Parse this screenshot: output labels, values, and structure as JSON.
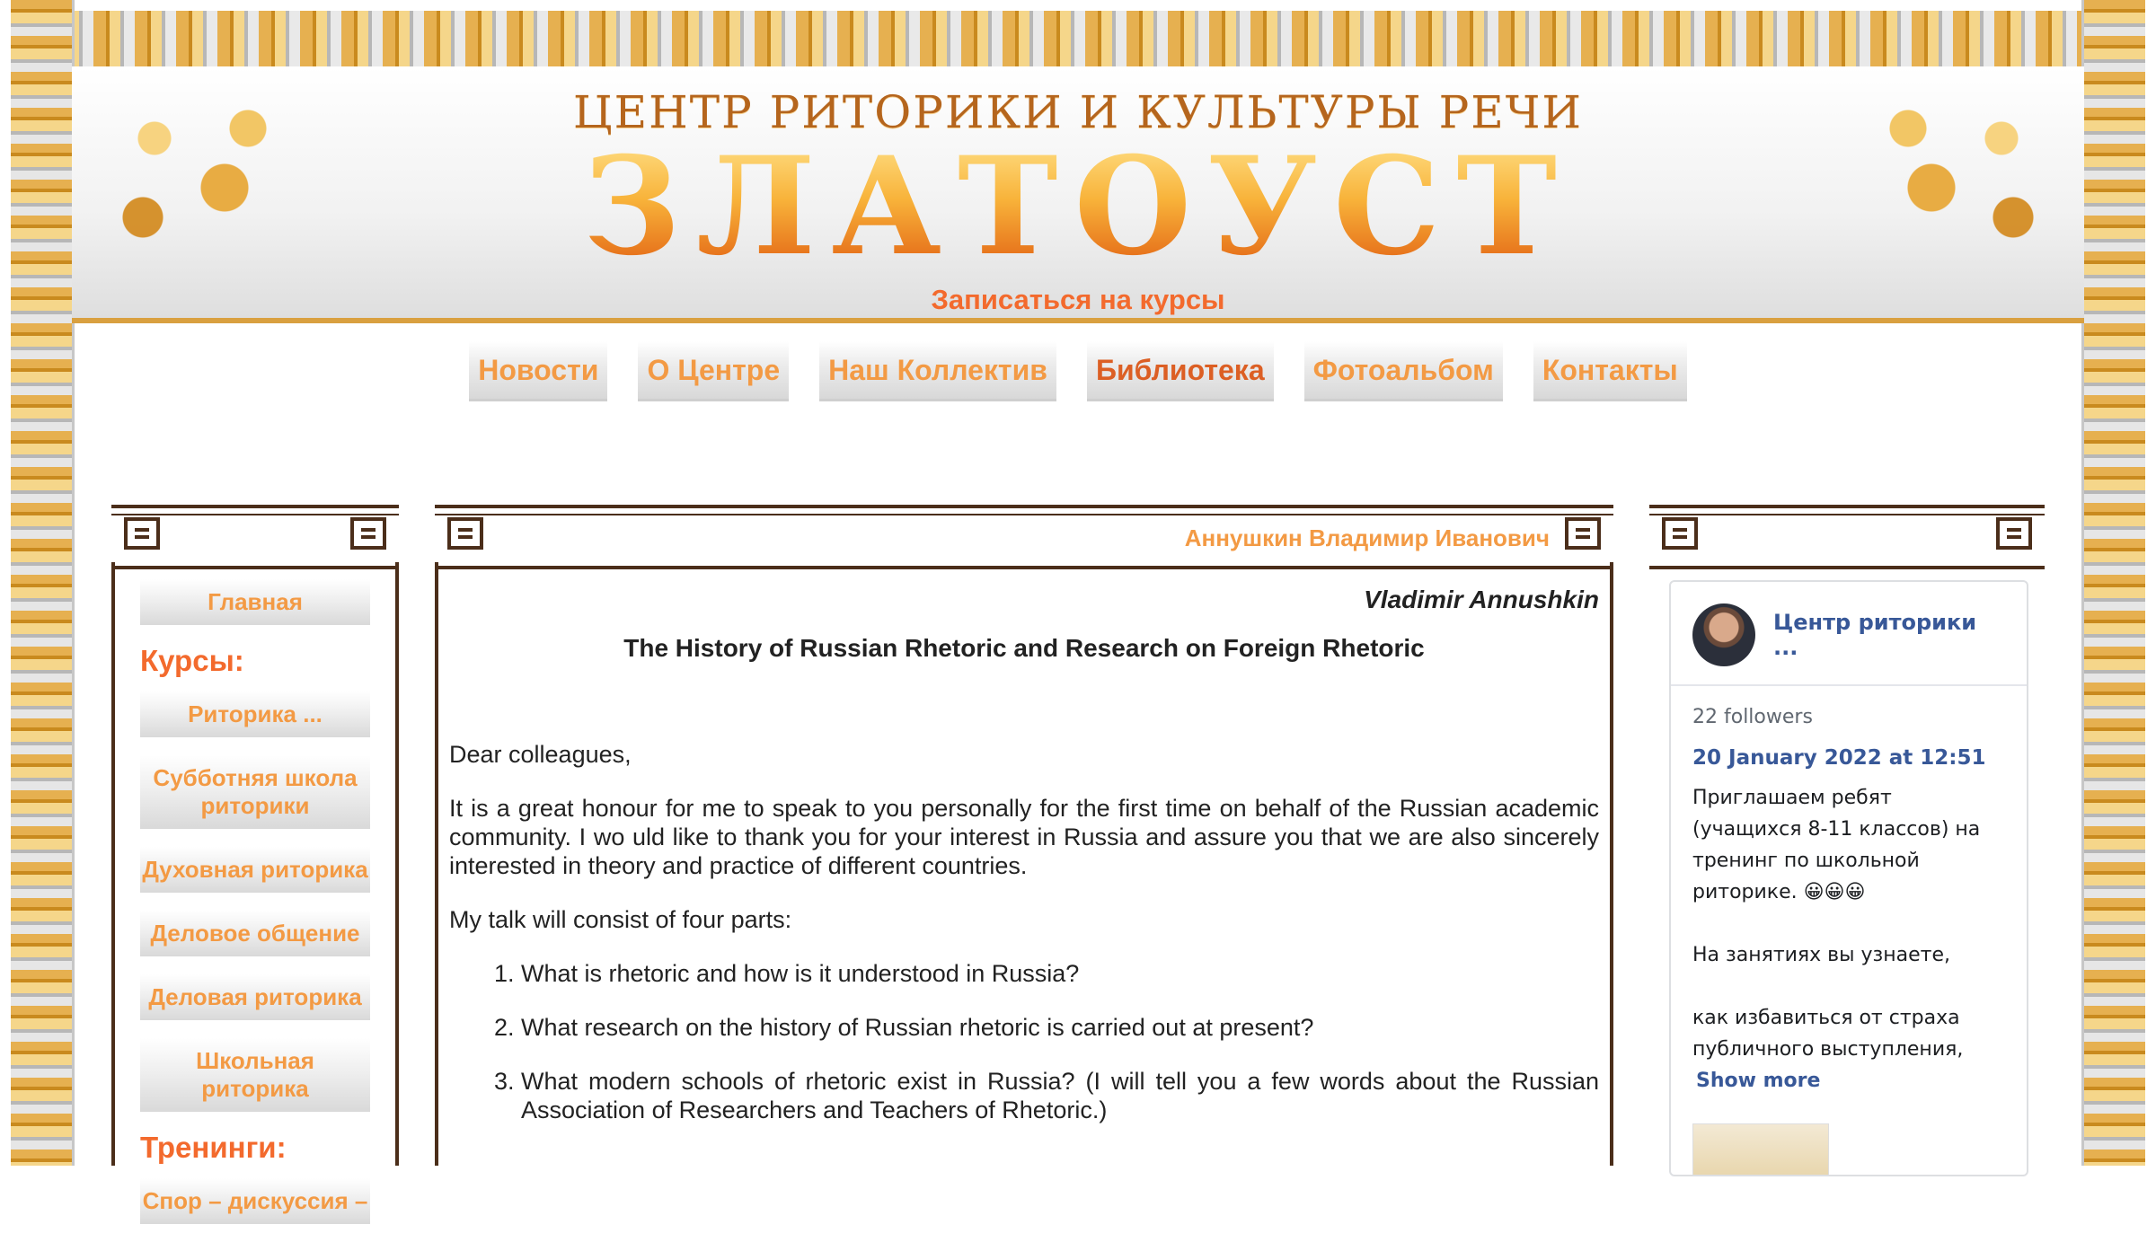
{
  "header": {
    "subtitle": "ЦЕНТР РИТОРИКИ И КУЛЬТУРЫ РЕЧИ",
    "logo": "ЗЛАТОУСТ",
    "signup_link": "Записаться на курсы"
  },
  "top_nav": {
    "items": [
      {
        "label": "Новости"
      },
      {
        "label": "О Центре"
      },
      {
        "label": "Наш Коллектив"
      },
      {
        "label": "Библиотека"
      },
      {
        "label": "Фотоальбом"
      },
      {
        "label": "Контакты"
      }
    ],
    "active": "Библиотека"
  },
  "left_menu": {
    "home": "Главная",
    "courses_heading": "Курсы:",
    "courses": [
      "Риторика ...",
      "Субботняя школа риторики",
      "Духовная риторика",
      "Деловое общение",
      "Деловая риторика",
      "Школьная риторика"
    ],
    "trainings_heading": "Тренинги:",
    "trainings": [
      "Спор – дискуссия –"
    ]
  },
  "article": {
    "author": "Аннушкин Владимир Иванович",
    "byline": "Vladimir Annushkin",
    "title": "The History of Russian Rhetoric and Research on Foreign Rhetoric",
    "paragraphs": [
      "Dear colleagues,",
      "It is a great honour for me to speak to you personally for the first time on behalf of the Russian academic community. I wo uld like to thank you for your interest in Russia and assure you that we are also sincerely interested in theory and practice of different countries.",
      "My talk will consist of four parts:"
    ],
    "list": [
      "What is rhetoric and how is it understood in Russia?",
      "What research on the history of Russian rhetoric is carried out at present?",
      "What modern schools of rhetoric exist in Russia? (I will tell you a few words about the Russian Association of Researchers and Teachers of Rhetoric.)"
    ]
  },
  "widget": {
    "page_name": "Центр риторики ...",
    "followers": "22 followers",
    "post_date": "20 January 2022 at 12:51",
    "post_line1": "Приглашаем ребят (учащихся 8-11 классов) на тренинг по школьной риторике. 😀😀😀",
    "post_line2": "На занятиях вы узнаете,",
    "post_line3": "как избавиться от страха публичного выступления,",
    "show_more": "Show more"
  },
  "colors": {
    "accent_orange": "#f39a44",
    "heading_orange": "#f36a2d",
    "frame_brown": "#4b2e1a",
    "fb_blue": "#385898"
  }
}
